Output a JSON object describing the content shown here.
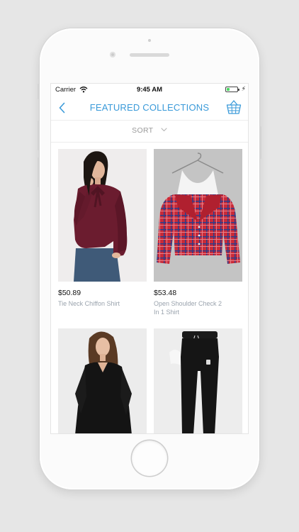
{
  "status_bar": {
    "carrier": "Carrier",
    "time": "9:45 AM",
    "battery_level": 0.25
  },
  "nav": {
    "title": "FEATURED COLLECTIONS",
    "back_icon": "chevron-left-icon",
    "basket_icon": "basket-icon"
  },
  "sort": {
    "label": "SORT",
    "icon": "chevron-down-icon"
  },
  "products": [
    {
      "price": "$50.89",
      "name": "Tie Neck Chiffon Shirt",
      "color": "#6b1c2f"
    },
    {
      "price": "$53.48",
      "name": "Open Shoulder Check 2 In 1 Shirt",
      "color": "#c92a38"
    },
    {
      "price": "",
      "name": "",
      "color": "#141414"
    },
    {
      "price": "",
      "name": "",
      "color": "#141414"
    }
  ],
  "colors": {
    "accent": "#3a9ad9",
    "background": "#e6e6e6"
  }
}
